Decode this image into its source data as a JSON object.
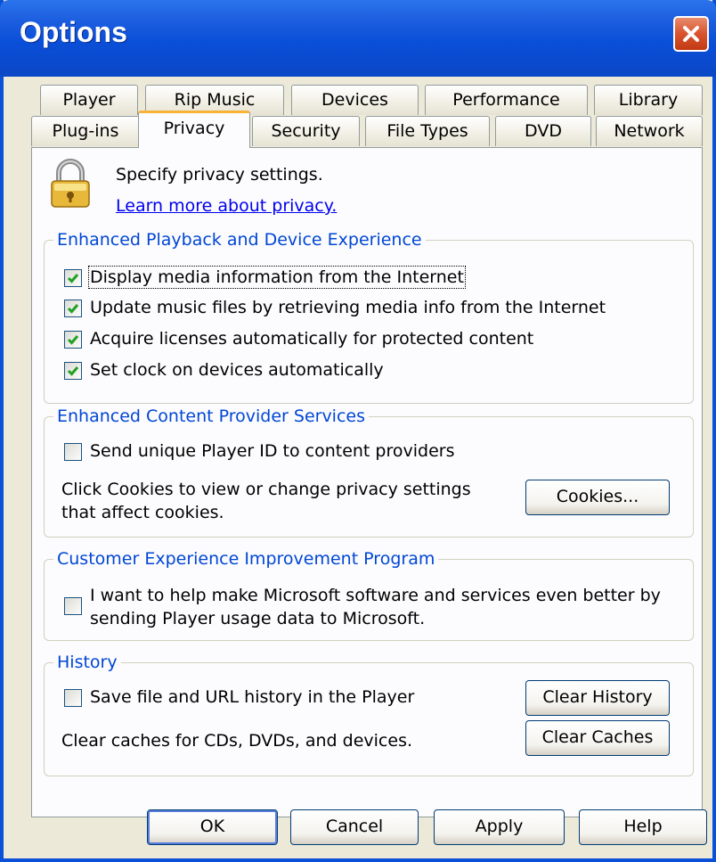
{
  "window": {
    "title": "Options"
  },
  "tabs": {
    "row1": [
      "Player",
      "Rip Music",
      "Devices",
      "Performance",
      "Library"
    ],
    "row2": [
      "Plug-ins",
      "Privacy",
      "Security",
      "File Types",
      "DVD",
      "Network"
    ],
    "active": "Privacy"
  },
  "intro": {
    "text": "Specify privacy settings.",
    "link": "Learn more about privacy.",
    "icon": "padlock-icon"
  },
  "playback_group": {
    "title": "Enhanced Playback and Device Experience",
    "items": [
      {
        "label": "Display media information from the Internet",
        "checked": true
      },
      {
        "label": "Update music files by retrieving media info from the Internet",
        "checked": true
      },
      {
        "label": "Acquire licenses automatically for protected content",
        "checked": true
      },
      {
        "label": "Set clock on devices automatically",
        "checked": true
      }
    ]
  },
  "provider_group": {
    "title": "Enhanced Content Provider Services",
    "send_id_label": "Send unique Player ID to content providers",
    "send_id_checked": false,
    "cookies_text_line1": "Click Cookies to view or change privacy settings",
    "cookies_text_line2": "that affect cookies.",
    "cookies_button": "Cookies..."
  },
  "ceip_group": {
    "title": "Customer Experience Improvement Program",
    "label_line1": "I want to help make Microsoft software and services even better by",
    "label_line2": "sending Player usage data to Microsoft.",
    "checked": false
  },
  "history_group": {
    "title": "History",
    "save_label": "Save file and URL history in the Player",
    "save_checked": false,
    "clear_history_button": "Clear History",
    "caches_text": "Clear caches for CDs, DVDs, and devices.",
    "clear_caches_button": "Clear Caches"
  },
  "footer": {
    "ok": "OK",
    "cancel": "Cancel",
    "apply": "Apply",
    "help": "Help"
  },
  "colors": {
    "title_blue": "#0a4fd8",
    "group_title": "#0046d5",
    "check_green": "#21a121",
    "link": "#0000ee",
    "tab_accent": "#f7b238"
  }
}
